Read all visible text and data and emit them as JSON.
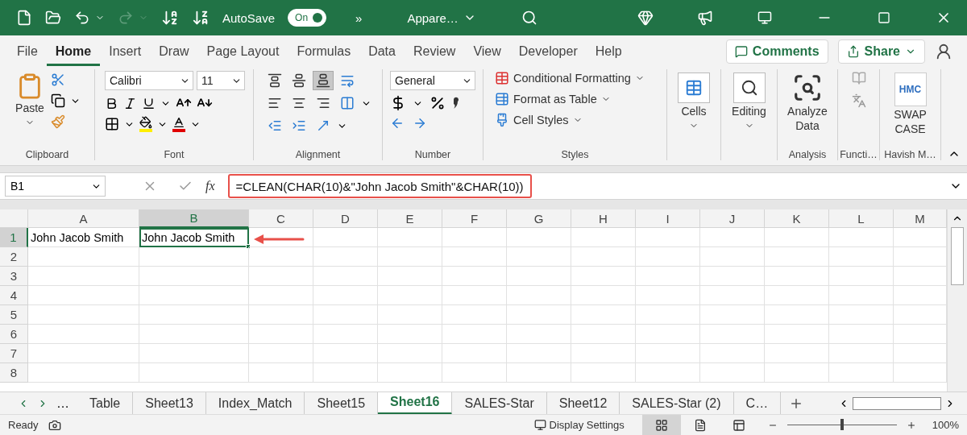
{
  "title_bar": {
    "autosave_label": "AutoSave",
    "autosave": {
      "label": "On",
      "on": true
    },
    "overflow": "»",
    "file_name": "Appare…"
  },
  "ribbon_tabs": [
    {
      "label": "File",
      "selected": false
    },
    {
      "label": "Home",
      "selected": true
    },
    {
      "label": "Insert",
      "selected": false
    },
    {
      "label": "Draw",
      "selected": false
    },
    {
      "label": "Page Layout",
      "selected": false
    },
    {
      "label": "Formulas",
      "selected": false
    },
    {
      "label": "Data",
      "selected": false
    },
    {
      "label": "Review",
      "selected": false
    },
    {
      "label": "View",
      "selected": false
    },
    {
      "label": "Developer",
      "selected": false
    },
    {
      "label": "Help",
      "selected": false
    }
  ],
  "actions": {
    "comments": "Comments",
    "share": "Share"
  },
  "ribbon": {
    "clipboard": {
      "label": "Clipboard",
      "paste": "Paste"
    },
    "font": {
      "label": "Font",
      "font_name": "Calibri",
      "font_size": "11"
    },
    "alignment": {
      "label": "Alignment",
      "buttons": [
        {
          "kind": "top",
          "selected": false
        },
        {
          "kind": "middle",
          "selected": false
        },
        {
          "kind": "bottom",
          "selected": true
        },
        {
          "kind": "wrap",
          "selected": false
        },
        {
          "kind": "left",
          "selected": false
        },
        {
          "kind": "center",
          "selected": false
        },
        {
          "kind": "right",
          "selected": false
        },
        {
          "kind": "merge",
          "selected": false
        },
        {
          "kind": "outdent",
          "selected": false
        },
        {
          "kind": "indent",
          "selected": false
        },
        {
          "kind": "orientation",
          "selected": false
        }
      ]
    },
    "number": {
      "label": "Number",
      "format": "General"
    },
    "styles": {
      "label": "Styles",
      "items": [
        "Conditional Formatting",
        "Format as Table",
        "Cell Styles"
      ]
    },
    "cells": {
      "label": "Cells"
    },
    "editing": {
      "label": "Editing"
    },
    "analysis": {
      "label": "Analysis",
      "button": "Analyze Data"
    },
    "functions": {
      "label": "Functi…",
      "disabled": true
    },
    "addin": {
      "label": "Havish M…",
      "logo": "HMC",
      "button": "SWAP CASE"
    }
  },
  "formula_bar": {
    "name_box": "B1",
    "fx": "fx",
    "formula": "=CLEAN(CHAR(10)&\"John Jacob Smith\"&CHAR(10))",
    "highlighted": true
  },
  "grid": {
    "columns": [
      {
        "label": "A",
        "selected": false
      },
      {
        "label": "B",
        "selected": true
      },
      {
        "label": "C",
        "selected": false
      },
      {
        "label": "D",
        "selected": false
      },
      {
        "label": "E",
        "selected": false
      },
      {
        "label": "F",
        "selected": false
      },
      {
        "label": "G",
        "selected": false
      },
      {
        "label": "H",
        "selected": false
      },
      {
        "label": "I",
        "selected": false
      },
      {
        "label": "J",
        "selected": false
      },
      {
        "label": "K",
        "selected": false
      },
      {
        "label": "L",
        "selected": false
      },
      {
        "label": "M",
        "selected": false
      }
    ],
    "rows": [
      {
        "label": "1",
        "selected": true,
        "cells": [
          {
            "text": "John Jacob Smith",
            "selected": false
          },
          {
            "text": "John Jacob Smith",
            "selected": true
          }
        ]
      },
      {
        "label": "2",
        "selected": false,
        "cells": []
      },
      {
        "label": "3",
        "selected": false,
        "cells": []
      },
      {
        "label": "4",
        "selected": false,
        "cells": []
      },
      {
        "label": "5",
        "selected": false,
        "cells": []
      },
      {
        "label": "6",
        "selected": false,
        "cells": []
      },
      {
        "label": "7",
        "selected": false,
        "cells": []
      },
      {
        "label": "8",
        "selected": false,
        "cells": []
      }
    ],
    "arrow_to_selection": true
  },
  "sheet_tabs": {
    "more": "…",
    "tabs": [
      {
        "label": "Table",
        "selected": false
      },
      {
        "label": "Sheet13",
        "selected": false
      },
      {
        "label": "Index_Match",
        "selected": false
      },
      {
        "label": "Sheet15",
        "selected": false
      },
      {
        "label": "Sheet16",
        "selected": true
      },
      {
        "label": "SALES-Star",
        "selected": false
      },
      {
        "label": "Sheet12",
        "selected": false
      },
      {
        "label": "SALES-Star (2)",
        "selected": false
      },
      {
        "label": "C…",
        "selected": false
      }
    ]
  },
  "status_bar": {
    "status": "Ready",
    "display_settings": "Display Settings",
    "views": [
      {
        "kind": "normal",
        "selected": true
      },
      {
        "kind": "page_layout",
        "selected": false
      },
      {
        "kind": "page_break",
        "selected": false
      }
    ],
    "zoom": {
      "level": 0.5,
      "reading": "100%"
    }
  }
}
